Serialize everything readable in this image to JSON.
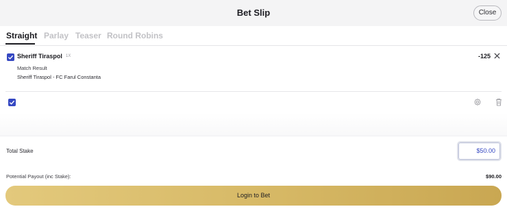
{
  "header": {
    "title": "Bet Slip",
    "close_label": "Close"
  },
  "tabs": [
    {
      "label": "Straight",
      "active": true
    },
    {
      "label": "Parlay",
      "active": false
    },
    {
      "label": "Teaser",
      "active": false
    },
    {
      "label": "Round Robins",
      "active": false
    }
  ],
  "bet": {
    "selected": true,
    "team": "Sheriff Tiraspol",
    "team_code": "1X",
    "odds": "-125",
    "market": "Match Result",
    "event": "Sheriff Tiraspol - FC Farul Constanta"
  },
  "controls": {
    "select_all_checked": true,
    "icons": [
      "gear-icon",
      "trash-icon"
    ]
  },
  "footer": {
    "total_stake_label": "Total Stake",
    "stake_value": "$50.00",
    "payout_label": "Potential Payout (inc Stake):",
    "payout_value": "$90.00",
    "login_label": "Login to Bet"
  },
  "colors": {
    "accent": "#3548c2",
    "button_gold": "#d6b865",
    "header_bg": "#f4f4f5"
  }
}
